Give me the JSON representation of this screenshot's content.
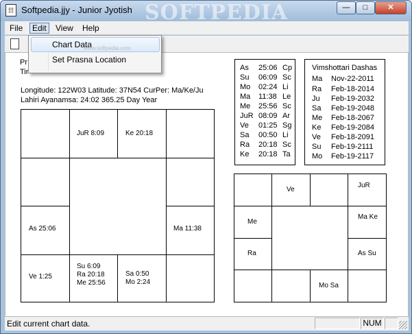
{
  "window": {
    "title": "Softpedia.jjy - Junior Jyotish",
    "watermark": "SOFTPEDIA",
    "min": "—",
    "max": "□",
    "close": "✕",
    "app_icon": "☷"
  },
  "menu": {
    "file": "File",
    "edit": "Edit",
    "view": "View",
    "help": "Help"
  },
  "dropdown": {
    "chart_data": "Chart Data",
    "set_prasna": "Set Prasna Location",
    "watermark": "www.softpedia.com"
  },
  "info": {
    "line1": "Pr",
    "line2": "Tir",
    "longitude_line": "Longitude: 122W03  Latitude: 37N54  CurPer: Ma/Ke/Ju",
    "ayanamsa_line": "Lahiri Ayanamsa: 24:02  365.25 Day Year"
  },
  "rasi_chart": {
    "ju": "JuR  8:09",
    "ke": "Ke 20:18",
    "as": "As 25:06",
    "ma": "Ma 11:38",
    "ve": "Ve  1:25",
    "su_ra_me": [
      "Su  6:09",
      "Ra 20:18",
      "Me 25:56"
    ],
    "sa_mo": [
      "Sa  0:50",
      "Mo  2:24"
    ]
  },
  "planet_positions": [
    {
      "p": "As",
      "t": "25:06",
      "s": "Cp"
    },
    {
      "p": "Su",
      "t": "06:09",
      "s": "Sc"
    },
    {
      "p": "Mo",
      "t": "02:24",
      "s": "Li"
    },
    {
      "p": "Ma",
      "t": "11:38",
      "s": "Le"
    },
    {
      "p": "Me",
      "t": "25:56",
      "s": "Sc"
    },
    {
      "p": "JuR",
      "t": "08:09",
      "s": "Ar"
    },
    {
      "p": "Ve",
      "t": "01:25",
      "s": "Sg"
    },
    {
      "p": "Sa",
      "t": "00:50",
      "s": "Li"
    },
    {
      "p": "Ra",
      "t": "20:18",
      "s": "Sc"
    },
    {
      "p": "Ke",
      "t": "20:18",
      "s": "Ta"
    }
  ],
  "dashas": {
    "title": "Vimshottari Dashas",
    "rows": [
      {
        "p": "Ma",
        "d": "Nov-22-2011"
      },
      {
        "p": "Ra",
        "d": "Feb-18-2014"
      },
      {
        "p": "Ju",
        "d": "Feb-19-2032"
      },
      {
        "p": "Sa",
        "d": "Feb-19-2048"
      },
      {
        "p": "Me",
        "d": "Feb-18-2067"
      },
      {
        "p": "Ke",
        "d": "Feb-19-2084"
      },
      {
        "p": "Ve",
        "d": "Feb-18-2091"
      },
      {
        "p": "Su",
        "d": "Feb-19-2111"
      },
      {
        "p": "Mo",
        "d": "Feb-19-2117"
      }
    ]
  },
  "navamsa_chart": {
    "ve": "Ve",
    "ju": "JuR",
    "me": "Me",
    "ma_ke": "Ma  Ke",
    "ra": "Ra",
    "as_su": "As  Su",
    "mo_sa": "Mo  Sa"
  },
  "status": {
    "text": "Edit current chart data.",
    "num": "NUM"
  }
}
